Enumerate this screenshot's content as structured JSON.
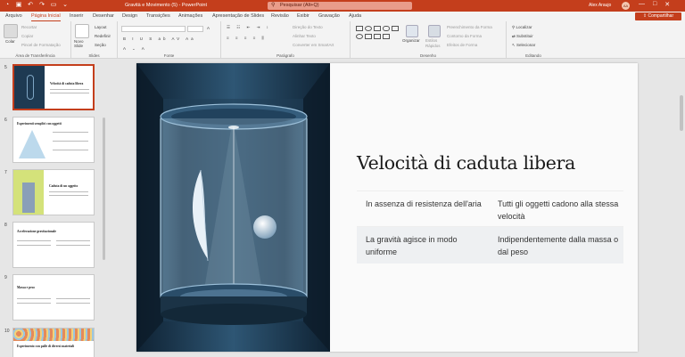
{
  "window": {
    "title": "Gravità e Movimento (5) - PowerPoint",
    "search_placeholder": "Pesquisar (Alt+Q)",
    "user": "Alex Araujo",
    "avatar": "AA",
    "minimize": "—",
    "maximize": "□",
    "close": "✕"
  },
  "tabs": [
    {
      "label": "Arquivo"
    },
    {
      "label": "Página Inicial",
      "active": true
    },
    {
      "label": "Inserir"
    },
    {
      "label": "Desenhar"
    },
    {
      "label": "Design"
    },
    {
      "label": "Transições"
    },
    {
      "label": "Animações"
    },
    {
      "label": "Apresentação de Slides"
    },
    {
      "label": "Revisão"
    },
    {
      "label": "Exibir"
    },
    {
      "label": "Gravação"
    },
    {
      "label": "Ajuda"
    }
  ],
  "share_label": "Compartilhar",
  "ribbon": {
    "clipboard": {
      "label": "Área de Transferência",
      "paste": "Colar",
      "cut": "Recortar",
      "copy": "Copiar",
      "format_painter": "Pincel de Formatação"
    },
    "slides": {
      "label": "Slides",
      "new_slide": "Novo Slide",
      "layout": "Layout",
      "reset": "Redefinir",
      "section": "Seção"
    },
    "font": {
      "label": "Fonte"
    },
    "paragraph": {
      "label": "Parágrafo",
      "text_direction": "Direção do Texto",
      "align_text": "Alinhar Texto",
      "smartart": "Converter em SmartArt"
    },
    "drawing": {
      "label": "Desenho",
      "arrange": "Organizar",
      "quick_styles": "Estilos Rápidos",
      "shape_fill": "Preenchimento da Forma",
      "shape_outline": "Contorno da Forma",
      "shape_effects": "Efeitos de Forma"
    },
    "editing": {
      "label": "Editando",
      "find": "Localizar",
      "replace": "Substituir",
      "select": "Selecionar"
    }
  },
  "thumbnails": [
    {
      "num": "5",
      "title": "Velocità di caduta libera",
      "selected": true
    },
    {
      "num": "6",
      "title": "Esperimenti semplici con oggetti"
    },
    {
      "num": "7",
      "title": "Caduta di un oggetto"
    },
    {
      "num": "8",
      "title": "Accelerazione gravitazionale"
    },
    {
      "num": "9",
      "title": "Massa e peso"
    },
    {
      "num": "10",
      "title": "Esperimento con palle di diversi materiali"
    }
  ],
  "slide": {
    "title": "Velocità di caduta libera",
    "table": [
      [
        "In assenza di resistenza dell'aria",
        "Tutti gli oggetti cadono alla stessa velocità"
      ],
      [
        "La gravità agisce in modo uniforme",
        "Indipendentemente dalla massa o dal peso"
      ]
    ]
  },
  "colors": {
    "accent": "#c43e1c",
    "slide_bg": "#fafafa",
    "art_dark": "#1b2f42"
  }
}
